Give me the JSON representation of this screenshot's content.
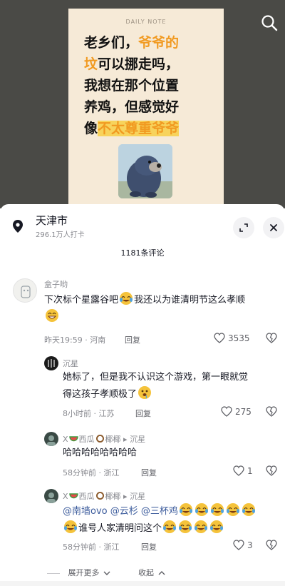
{
  "video": {
    "note_header": "DAILY NOTE",
    "lines": [
      {
        "a": "老乡们，",
        "b": "爷爷的"
      },
      {
        "a": "坟",
        "b": "可以挪走吗，"
      },
      {
        "a": "我想在那个位置",
        "b": ""
      },
      {
        "a": "养鸡，但感觉好",
        "b": ""
      },
      {
        "a": "像",
        "b": "不太尊重爷爷"
      }
    ]
  },
  "location": {
    "name": "天津市",
    "checkins": "296.1万人打卡"
  },
  "comments_header": "1181条评论",
  "comments": [
    {
      "username": "盒子哟",
      "line1_before": "下次标个星露谷吧",
      "line1_after": "我还以为谁清明节这么孝顺",
      "time": "昨天19:59 · 河南",
      "reply": "回复",
      "likes": "3535"
    },
    {
      "username": "沉星",
      "line1": "她标了，但是我不认识这个游戏，第一眼就觉",
      "line2": "得这孩子孝顺极了",
      "time": "8小时前 · 江苏",
      "reply": "回复",
      "likes": "275"
    },
    {
      "username_a": "X",
      "username_b": "西瓜",
      "username_c": "椰椰",
      "arrow": "▸",
      "username_target": "沉星",
      "text": "哈哈哈哈哈哈哈哈",
      "time": "58分钟前 · 浙江",
      "reply": "回复",
      "likes": "1"
    },
    {
      "username_a": "X",
      "username_b": "西瓜",
      "username_c": "椰椰",
      "arrow": "▸",
      "username_target": "沉星",
      "mentions": [
        "@南墙ovo",
        "@云杉",
        "@三杯鸡"
      ],
      "line2": "谁号人家清明问这个",
      "time": "58分钟前 · 浙江",
      "reply": "回复",
      "likes": "3"
    }
  ],
  "footer": {
    "expand_more": "展开更多",
    "collapse": "收起"
  },
  "colors": {
    "accent_orange": "#f19a21",
    "highlight_yellow": "#f7d35c",
    "mention_blue": "#3b5b9c",
    "meta_gray": "#8a8b91"
  }
}
